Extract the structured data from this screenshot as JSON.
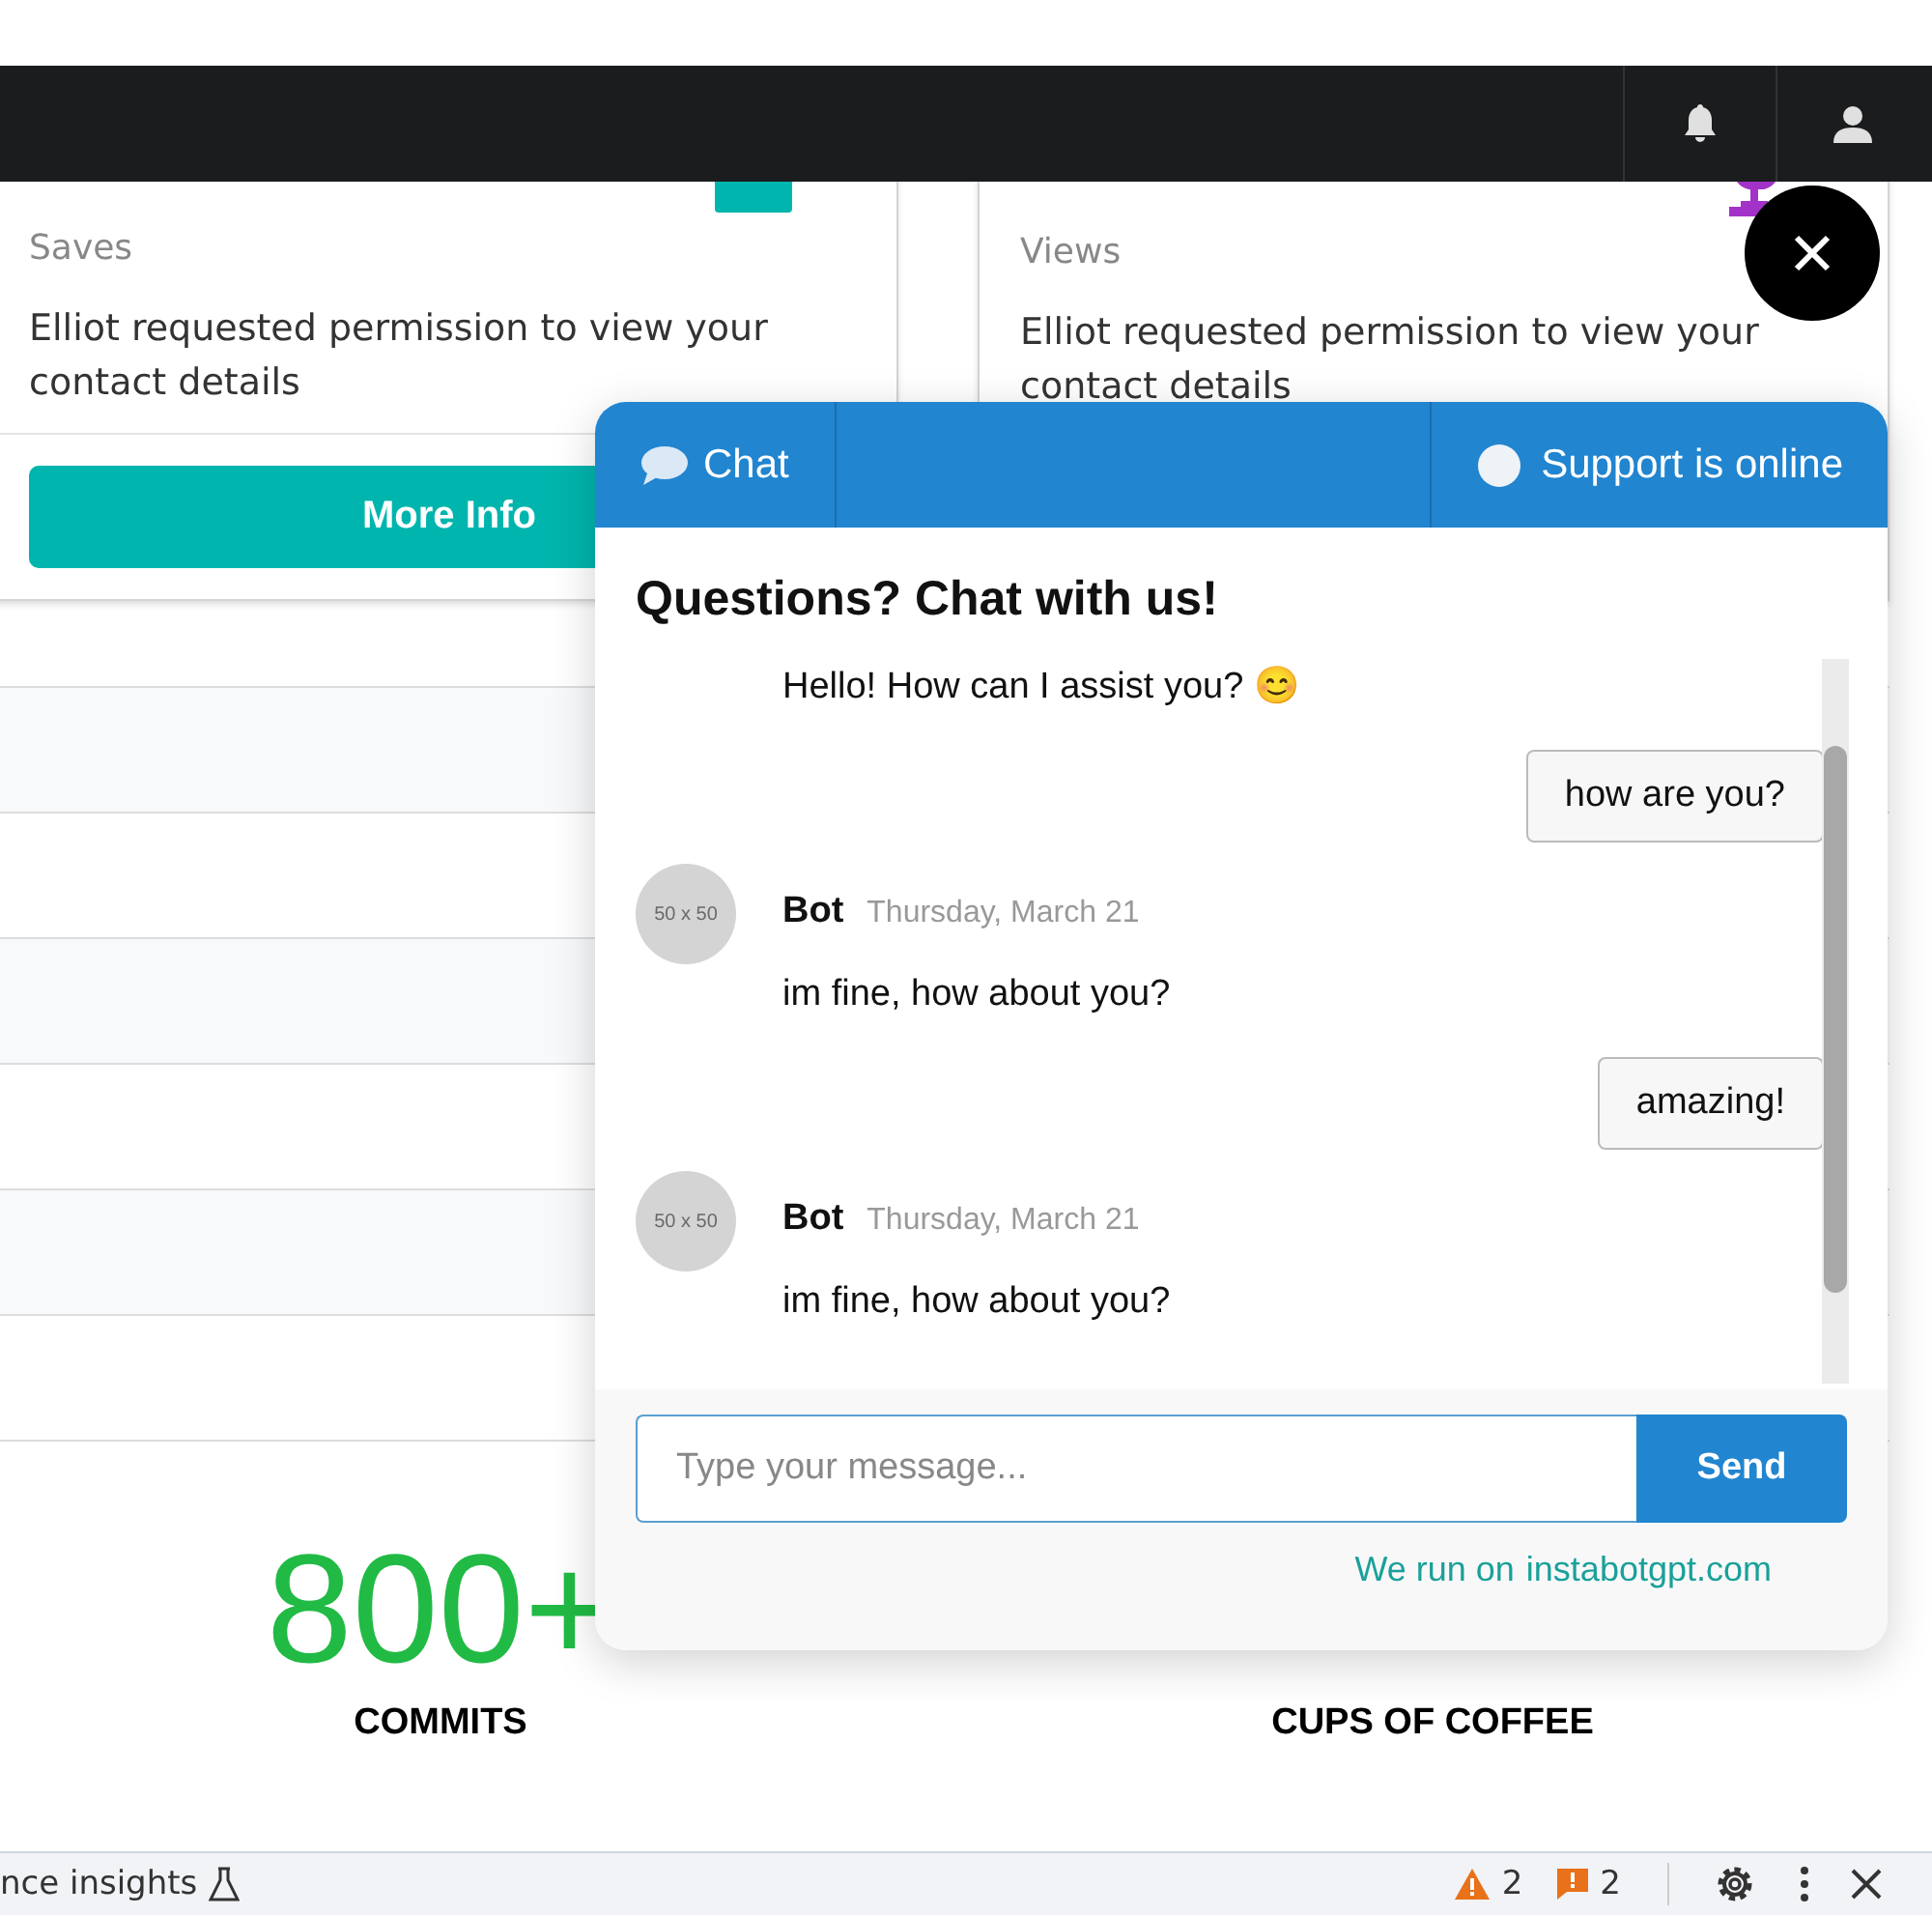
{
  "cards": [
    {
      "label": "Saves",
      "description": "Elliot requested permission to view your contact details",
      "color": "#00b5ad",
      "button": "More Info"
    },
    {
      "label": "Views",
      "description": "Elliot requested permission to view your contact details",
      "color": "#a333c8"
    }
  ],
  "stats": [
    {
      "value": "800+",
      "label": "COMMITS",
      "color": "#21ba45"
    },
    {
      "label": "CUPS OF COFFEE"
    }
  ],
  "chat": {
    "tab": "Chat",
    "status": "Support is online",
    "title": "Questions? Chat with us!",
    "messages": [
      {
        "kind": "bot",
        "text": "Hello! How can I assist you? 😊"
      },
      {
        "kind": "user",
        "text": "how are you?"
      },
      {
        "kind": "bot",
        "avatar": "50 x 50",
        "name": "Bot",
        "date": "Thursday, March 21",
        "text": "im fine, how about you?"
      },
      {
        "kind": "user",
        "text": "amazing!"
      },
      {
        "kind": "bot",
        "avatar": "50 x 50",
        "name": "Bot",
        "date": "Thursday, March 21",
        "text": "im fine, how about you?"
      }
    ],
    "input": {
      "placeholder": "Type your message..."
    },
    "send": "Send",
    "footer": {
      "text": "We run on",
      "link": "instabotgpt.com"
    }
  },
  "devtools": {
    "label": "nce insights",
    "warnings": "2",
    "errors": "2"
  }
}
